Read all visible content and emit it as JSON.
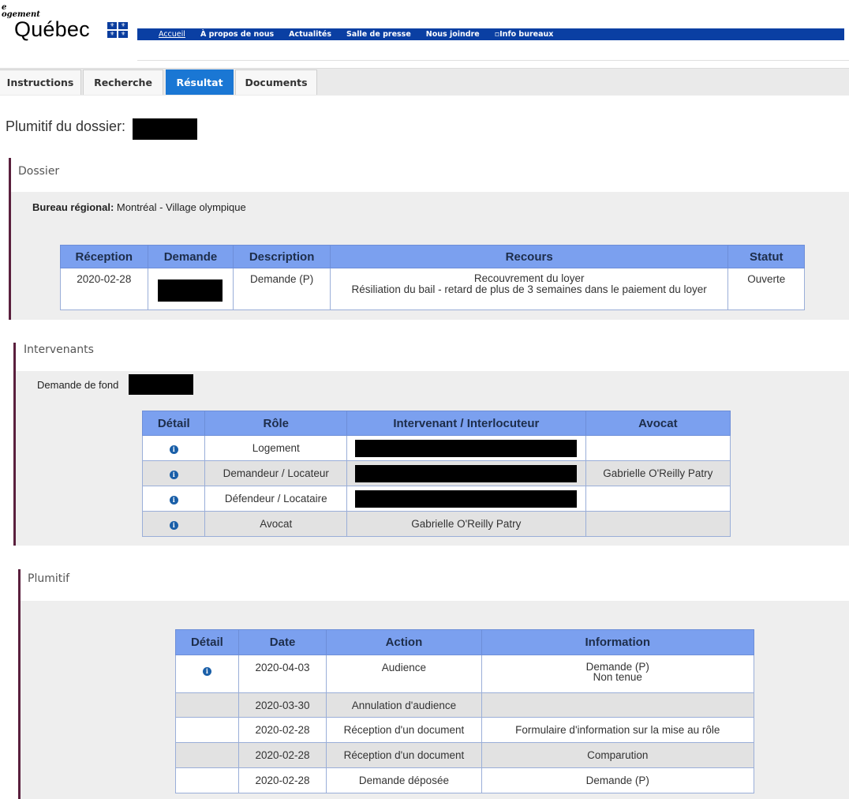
{
  "header": {
    "logo_line1": "e",
    "logo_line2": "ogement",
    "logo_main": "Québec",
    "nav": [
      "Accueil",
      "À propos de nous",
      "Actualités",
      "Salle de presse",
      "Nous joindre",
      "▫Info bureaux"
    ]
  },
  "tabs": [
    "Instructions",
    "Recherche",
    "Résultat",
    "Documents"
  ],
  "active_tab": "Résultat",
  "dossier_label": "Plumitif du dossier:",
  "dossier_section": {
    "title": "Dossier",
    "bureau_label": "Bureau régional:",
    "bureau_value": "Montréal - Village olympique",
    "headers": [
      "Réception",
      "Demande",
      "Description",
      "Recours",
      "Statut"
    ],
    "row": {
      "reception": "2020-02-28",
      "description": "Demande (P)",
      "recours_line1": "Recouvrement du loyer",
      "recours_line2": "Résiliation du bail - retard de plus de 3 semaines dans le paiement du loyer",
      "statut": "Ouverte"
    }
  },
  "intervenants_section": {
    "title": "Intervenants",
    "subtitle": "Demande de fond",
    "headers": [
      "Détail",
      "Rôle",
      "Intervenant / Interlocuteur",
      "Avocat"
    ],
    "rows": [
      {
        "role": "Logement",
        "intervenant": "",
        "avocat": ""
      },
      {
        "role": "Demandeur / Locateur",
        "intervenant": "",
        "avocat": "Gabrielle O'Reilly Patry"
      },
      {
        "role": "Défendeur / Locataire",
        "intervenant": "",
        "avocat": ""
      },
      {
        "role": "Avocat",
        "intervenant": "Gabrielle O'Reilly Patry",
        "avocat": ""
      }
    ]
  },
  "plumitif_section": {
    "title": "Plumitif",
    "headers": [
      "Détail",
      "Date",
      "Action",
      "Information"
    ],
    "rows": [
      {
        "date": "2020-04-03",
        "action": "Audience",
        "info_line1": "Demande (P)",
        "info_line2": "Non tenue"
      },
      {
        "date": "2020-03-30",
        "action": "Annulation d'audience",
        "info_line1": "",
        "info_line2": ""
      },
      {
        "date": "2020-02-28",
        "action": "Réception d'un document",
        "info_line1": "Formulaire d'information sur la mise au rôle",
        "info_line2": ""
      },
      {
        "date": "2020-02-28",
        "action": "Réception d'un document",
        "info_line1": "Comparution",
        "info_line2": ""
      },
      {
        "date": "2020-02-28",
        "action": "Demande déposée",
        "info_line1": "Demande (P)",
        "info_line2": ""
      }
    ]
  },
  "icon_info": "i",
  "colors": {
    "nav_bg": "#0a3fa3",
    "tab_active": "#1a77d4",
    "table_header": "#7ba0ef",
    "section_bar": "#5a1f3d"
  }
}
